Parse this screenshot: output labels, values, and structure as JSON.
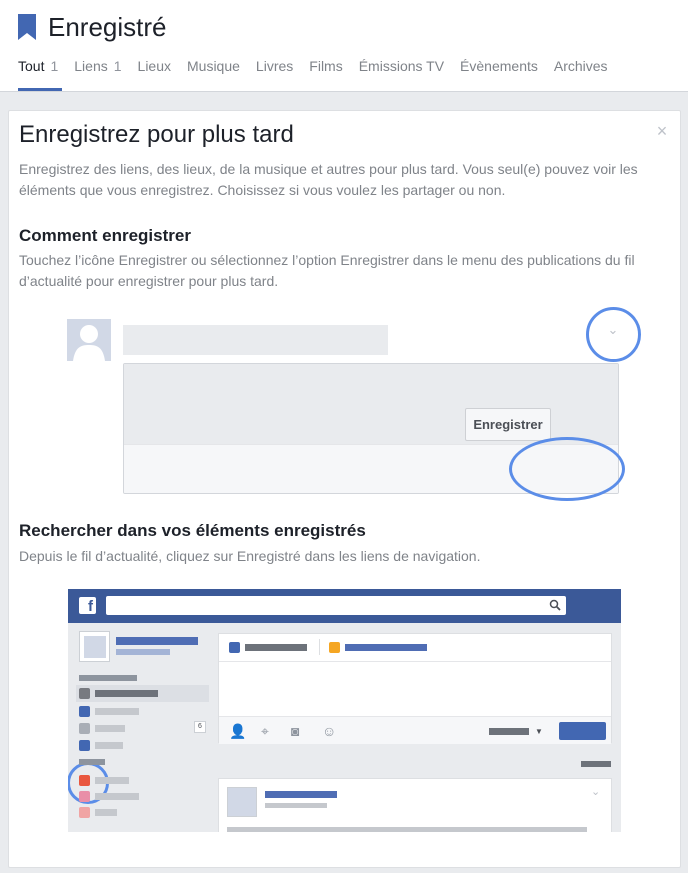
{
  "header": {
    "title": "Enregistré",
    "tabs": [
      {
        "label": "Tout",
        "count": "1",
        "active": true
      },
      {
        "label": "Liens",
        "count": "1"
      },
      {
        "label": "Lieux"
      },
      {
        "label": "Musique"
      },
      {
        "label": "Livres"
      },
      {
        "label": "Films"
      },
      {
        "label": "Émissions TV"
      },
      {
        "label": "Évènements"
      },
      {
        "label": "Archives"
      }
    ]
  },
  "card": {
    "title": "Enregistrez pour plus tard",
    "intro": "Enregistrez des liens, des lieux, de la musique et autres pour plus tard. Vous seul(e) pouvez voir les éléments que vous enregistrez. Choisissez si vous voulez les partager ou non.",
    "section1": {
      "title": "Comment enregistrer",
      "text": "Touchez l’icône Enregistrer ou sélectionnez l’option Enregistrer dans le menu des publications du fil d’actualité pour enregistrer pour plus tard.",
      "save_button": "Enregistrer"
    },
    "section2": {
      "title": "Rechercher dans vos éléments enregistrés",
      "text": "Depuis le fil d’actualité, cliquez sur Enregistré dans les liens de navigation.",
      "logo_letter": "f",
      "sidebar_badge": "6"
    }
  },
  "colors": {
    "accent": "#4267b2",
    "highlight_ring": "#5b8de8",
    "facebook_blue": "#3b5998"
  }
}
